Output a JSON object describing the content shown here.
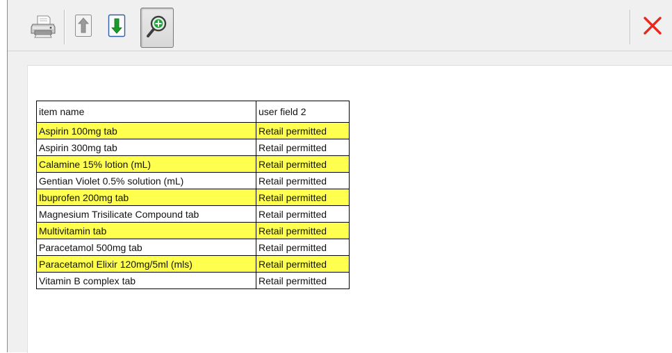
{
  "toolbar": {
    "buttons": [
      {
        "name": "print-button",
        "icon": "printer-icon"
      },
      {
        "name": "page-up-button",
        "icon": "arrow-up-icon"
      },
      {
        "name": "page-down-button",
        "icon": "arrow-down-icon"
      },
      {
        "name": "zoom-button",
        "icon": "magnifier-plus-icon",
        "pressed": true
      }
    ],
    "close_icon": "close-icon",
    "colors": {
      "close": "#e8281e",
      "arrow_down": "#1a9a2a",
      "zoom_plus": "#1ea43a"
    }
  },
  "report": {
    "headers": [
      "item  name",
      "user  field  2"
    ],
    "rows": [
      {
        "item": "Aspirin 100mg tab",
        "field": "Retail permitted",
        "highlight": true
      },
      {
        "item": "Aspirin 300mg tab",
        "field": "Retail permitted",
        "highlight": false
      },
      {
        "item": "Calamine 15% lotion (mL)",
        "field": "Retail permitted",
        "highlight": true
      },
      {
        "item": "Gentian Violet 0.5% solution (mL)",
        "field": "Retail permitted",
        "highlight": false
      },
      {
        "item": "Ibuprofen 200mg tab",
        "field": "Retail permitted",
        "highlight": true
      },
      {
        "item": "Magnesium Trisilicate Compound tab",
        "field": "Retail permitted",
        "highlight": false
      },
      {
        "item": "Multivitamin tab",
        "field": "Retail permitted",
        "highlight": true
      },
      {
        "item": "Paracetamol 500mg tab",
        "field": "Retail permitted",
        "highlight": false
      },
      {
        "item": "Paracetamol Elixir 120mg/5ml (mls)",
        "field": "Retail permitted",
        "highlight": true
      },
      {
        "item": "Vitamin B complex tab",
        "field": "Retail permitted",
        "highlight": false
      }
    ],
    "highlight_color": "#ffff4d"
  }
}
